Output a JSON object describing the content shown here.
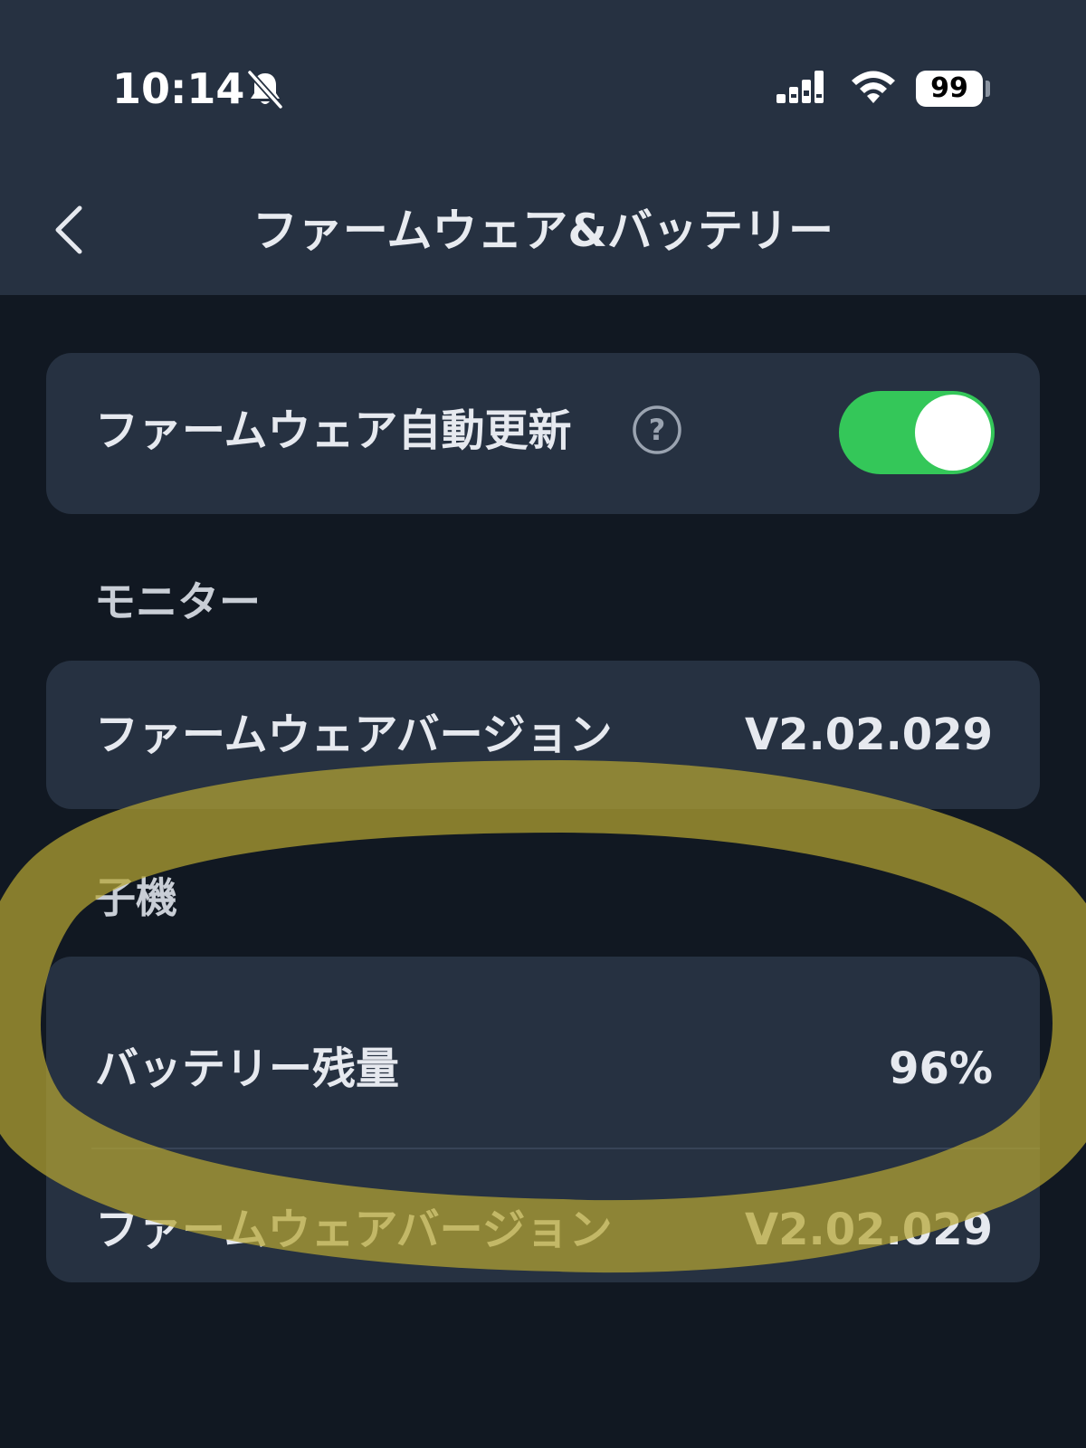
{
  "status_bar": {
    "time": "10:14",
    "battery_level": "99",
    "icons": [
      "bell-slash-icon",
      "signal-icon",
      "wifi-icon",
      "battery-icon"
    ]
  },
  "nav": {
    "back_icon": "chevron-left-icon",
    "title": "ファームウェア&バッテリー"
  },
  "auto_update": {
    "label": "ファームウェア自動更新",
    "help_icon": "question-circle-icon",
    "toggle_on": true
  },
  "monitor": {
    "header": "モニター",
    "firmware_label": "ファームウェアバージョン",
    "firmware_value": "V2.02.029"
  },
  "child": {
    "header": "子機",
    "battery_label": "バッテリー残量",
    "battery_value": "96%",
    "firmware_label": "ファームウェアバージョン",
    "firmware_value": "V2.02.029"
  },
  "colors": {
    "background": "#111822",
    "card": "#263141",
    "toggle_on": "#34c759",
    "highlight": "#b5a532"
  }
}
